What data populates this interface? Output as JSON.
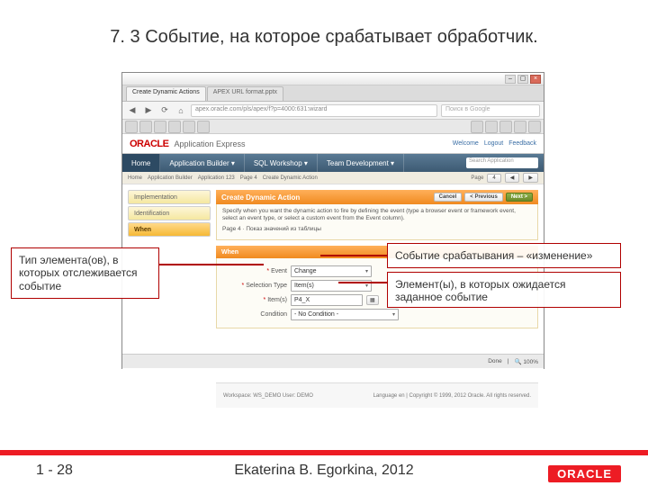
{
  "slide": {
    "title": "7. 3 Событие, на которое срабатывает обработчик.",
    "page": "1 - 28",
    "author": "Ekaterina B. Egorkina, 2012",
    "footer_logo": "ORACLE"
  },
  "callouts": {
    "left": "Тип элемента(ов), в которых отслеживается событие",
    "right1": "Событие срабатывания – «изменение»",
    "right2": "Элемент(ы), в которых ожидается заданное событие"
  },
  "window": {
    "close": "×",
    "tab1": "Create Dynamic Actions",
    "tab2": "APEX URL format.pptx",
    "url": "apex.oracle.com/pls/apex/f?p=4000:631:wizard",
    "search_ph": "Поиск в Google",
    "toolbar_icons": 12
  },
  "apex": {
    "logo": "ORACLE",
    "app_name": "Application Express",
    "top_links": [
      "Welcome",
      "Logout",
      "Feedback"
    ],
    "menu": {
      "home": "Home",
      "items": [
        "Application Builder ▾",
        "SQL Workshop ▾",
        "Team Development ▾"
      ],
      "search_ph": "Search Application"
    },
    "breadcrumb": [
      "Home",
      "Application Builder",
      "Application 123",
      "Page 4",
      "Create Dynamic Action"
    ],
    "page_ctrl_label": "Page",
    "page_num": "4",
    "buttons": {
      "cancel": "Cancel",
      "prev": "< Previous",
      "next": "Next >"
    }
  },
  "wizard": {
    "steps": [
      "Implementation",
      "Identification",
      "When"
    ],
    "panel_title": "Create Dynamic Action",
    "hint1": "Specify when you want the dynamic action to fire by defining the event (type a browser event or framework event, select an event type, or select a custom event from the Event column).",
    "hint2": "Page 4 · Показ значений из таблицы",
    "when_title": "When",
    "fields": {
      "event_label": "Event",
      "event_value": "Change",
      "seltype_label": "Selection Type",
      "seltype_value": "Item(s)",
      "items_label": "Item(s)",
      "items_value": "P4_X",
      "items_picker": "▦",
      "cond_label": "Condition",
      "cond_value": "- No Condition -"
    }
  },
  "footer_strip": {
    "left": "Workspace: WS_DEMO   User: DEMO",
    "right": "Language en | Copyright © 1999, 2012 Oracle. All rights reserved."
  },
  "status": {
    "done": "Done",
    "zoom": "100%"
  }
}
